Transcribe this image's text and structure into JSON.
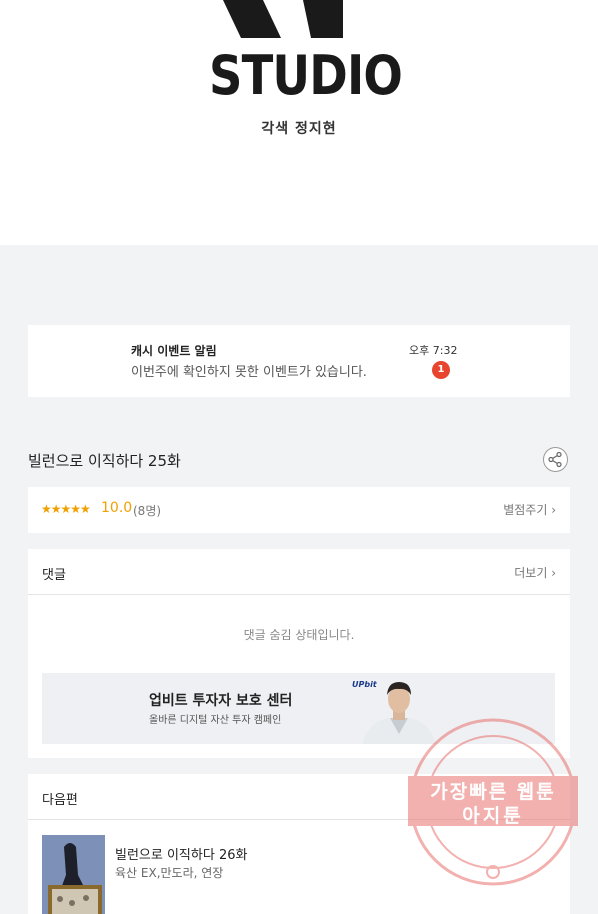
{
  "header": {
    "logo_word": "STUDIO",
    "credit": "각색 정지현"
  },
  "notification": {
    "title": "캐시 이벤트 알림",
    "body": "이번주에 확인하지 못한 이벤트가 있습니다.",
    "time": "오후 7:32",
    "badge": "1"
  },
  "episode": {
    "title": "빌런으로 이직하다 25화",
    "share_icon": "share-icon"
  },
  "rating": {
    "stars": "★★★★★",
    "score": "10.0",
    "count": "(8명)",
    "rate_label": "별점주기 ›"
  },
  "comments": {
    "heading": "댓글",
    "more_label": "더보기 ›",
    "hidden_message": "댓글 숨김 상태입니다."
  },
  "ad": {
    "title": "업비트 투자자 보호 센터",
    "subtitle": "올바른 디지털 자산 투자 캠페인",
    "brand": "UPbit"
  },
  "next": {
    "heading": "다음편",
    "title": "빌런으로 이직하다 26화",
    "genre": "육산 EX,만도라, 연장"
  },
  "watermark": {
    "line1": "가장빠른 웹툰",
    "line2": "아지툰"
  }
}
